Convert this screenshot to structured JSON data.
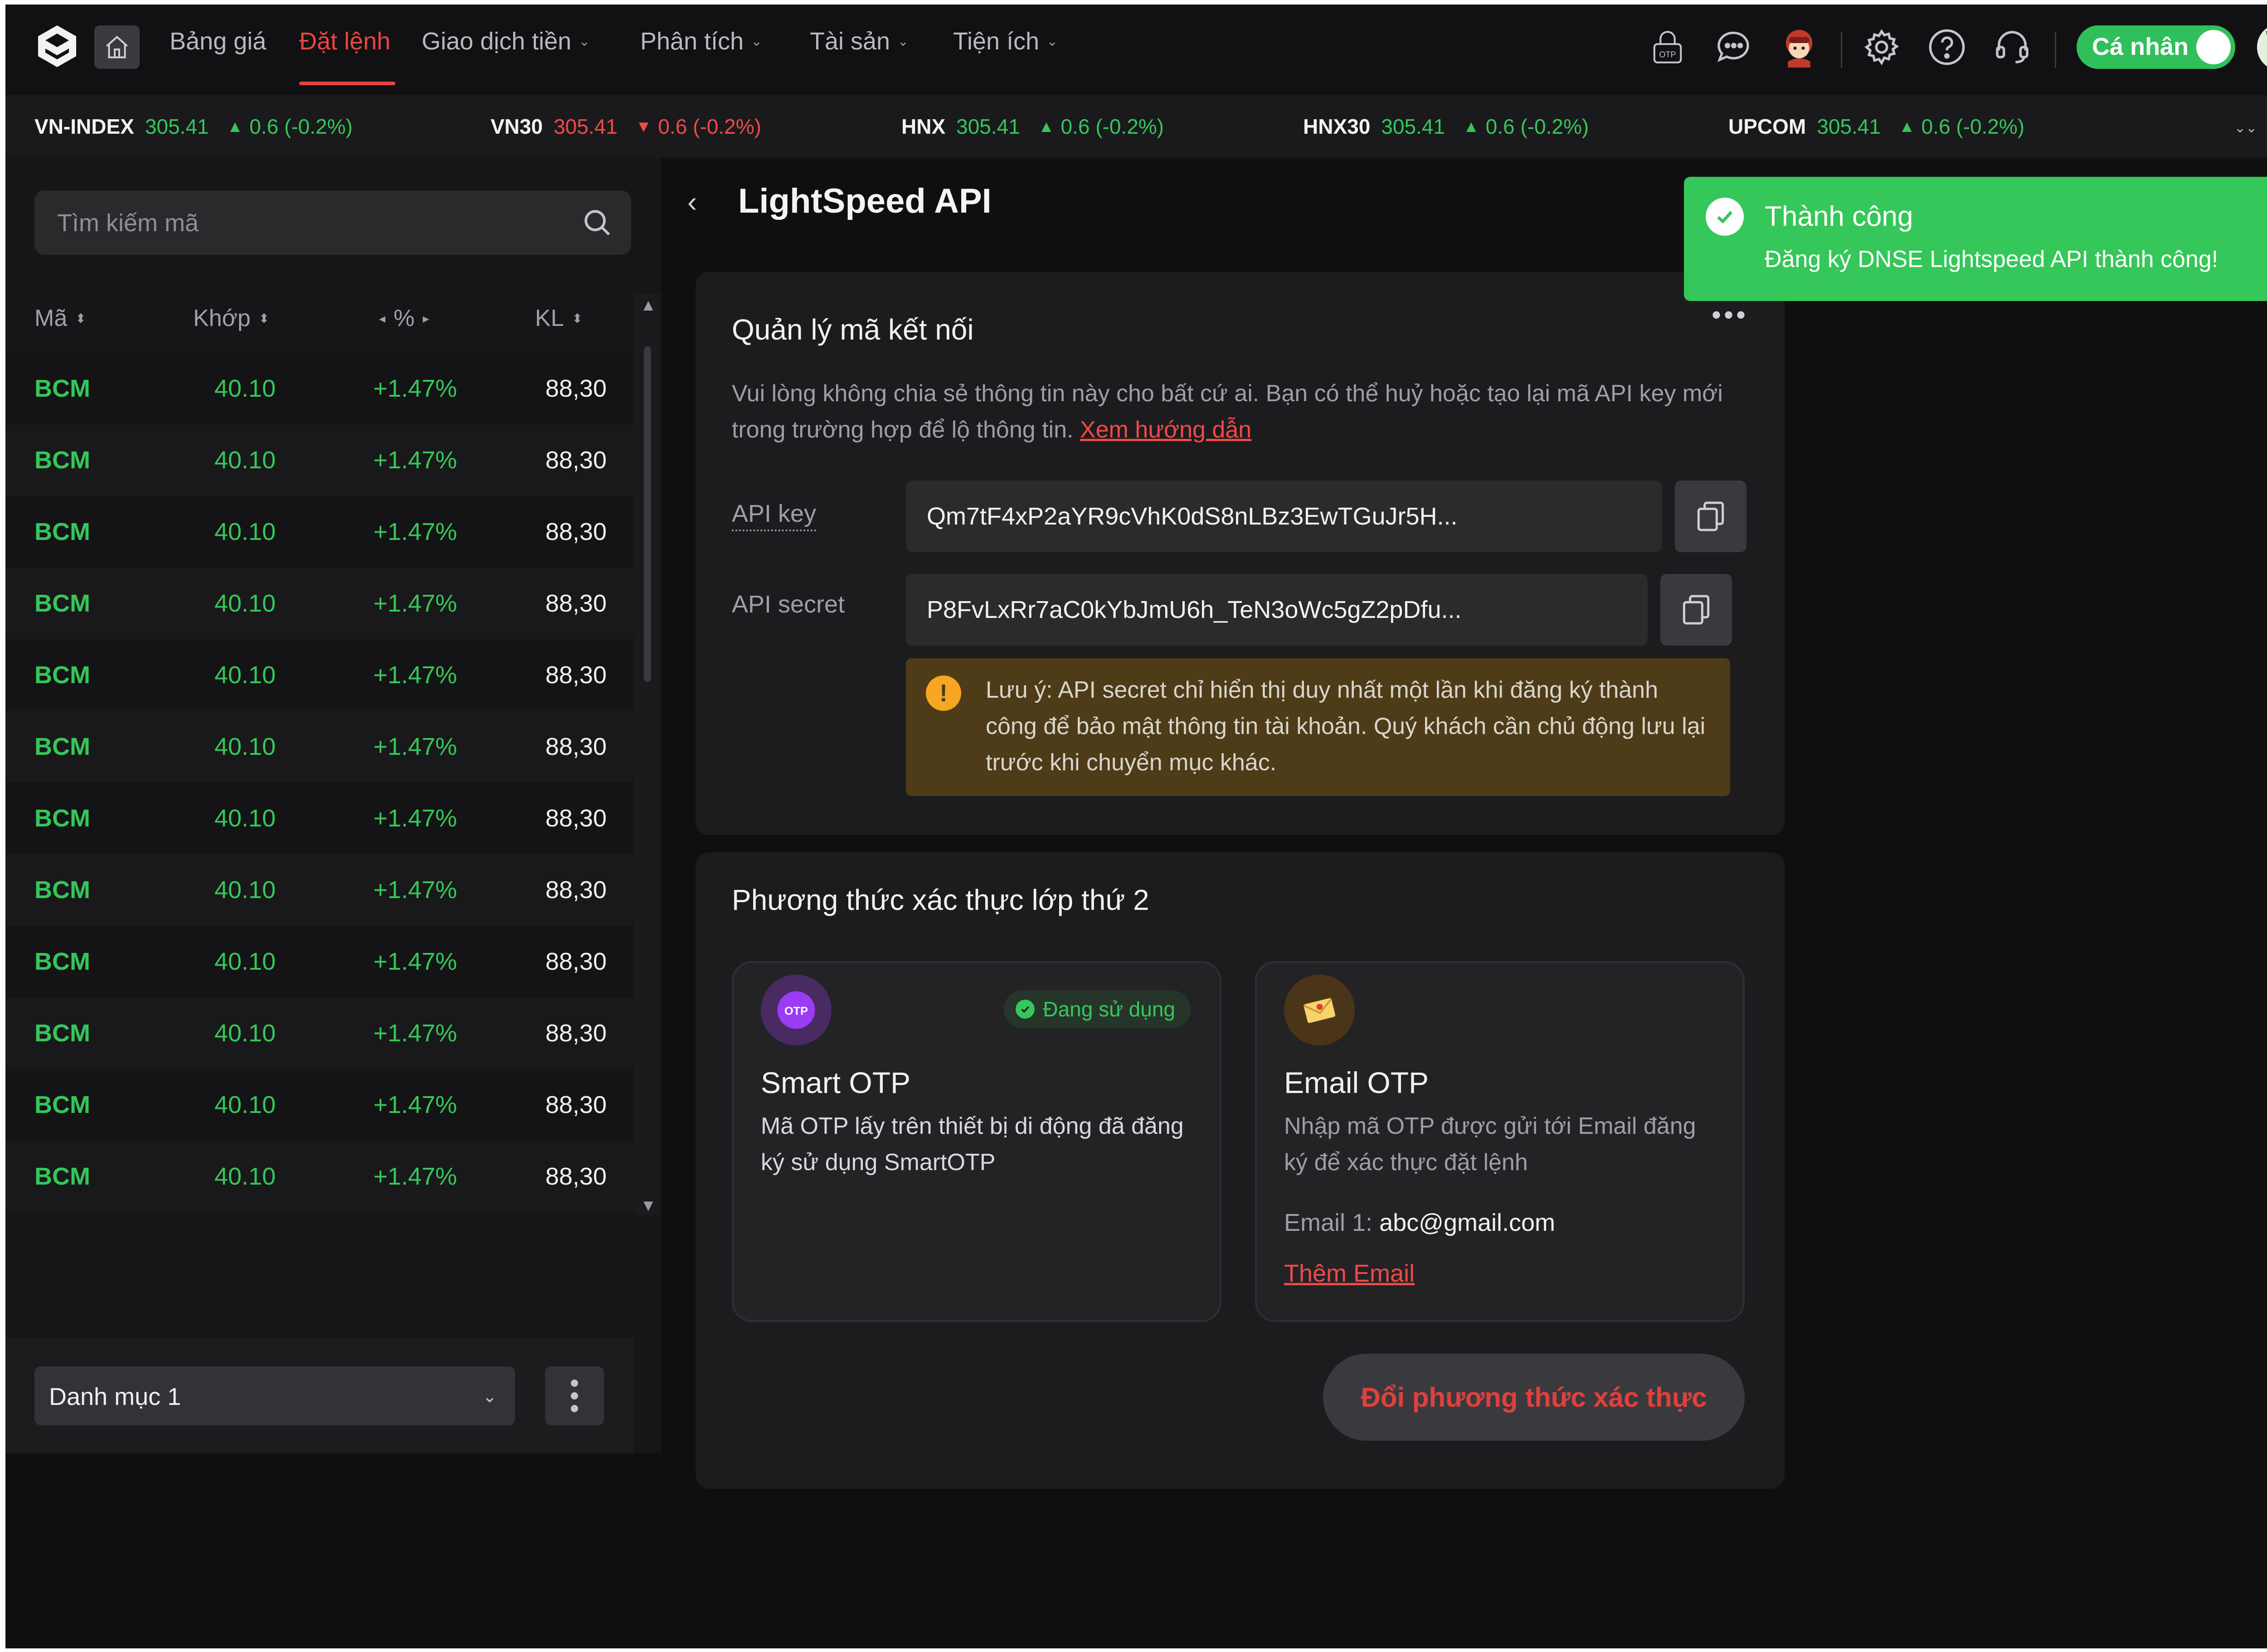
{
  "nav": {
    "items": [
      {
        "label": "Bảng giá",
        "has_menu": false,
        "active": false
      },
      {
        "label": "Đặt lệnh",
        "has_menu": false,
        "active": true
      },
      {
        "label": "Giao dịch tiền",
        "has_menu": true,
        "active": false
      },
      {
        "label": "Phân tích",
        "has_menu": true,
        "active": false
      },
      {
        "label": "Tài sản",
        "has_menu": true,
        "active": false
      },
      {
        "label": "Tiện ích",
        "has_menu": true,
        "active": false
      }
    ],
    "otp_icon_label": "OTP",
    "toggle_label": "Cá nhân",
    "icons": [
      "logo-icon",
      "home-icon",
      "otp-icon",
      "chat-icon",
      "mascot-icon",
      "settings-icon",
      "help-icon",
      "support-icon",
      "avatar"
    ]
  },
  "ticker": [
    {
      "name": "VN-INDEX",
      "value": "305.41",
      "change": "0.6 (-0.2%)",
      "direction": "up"
    },
    {
      "name": "VN30",
      "value": "305.41",
      "change": "0.6 (-0.2%)",
      "direction": "down"
    },
    {
      "name": "HNX",
      "value": "305.41",
      "change": "0.6 (-0.2%)",
      "direction": "up"
    },
    {
      "name": "HNX30",
      "value": "305.41",
      "change": "0.6 (-0.2%)",
      "direction": "up"
    },
    {
      "name": "UPCOM",
      "value": "305.41",
      "change": "0.6 (-0.2%)",
      "direction": "up"
    }
  ],
  "ticker_more_label": "Mở",
  "watchlist": {
    "search_placeholder": "Tìm kiếm mã",
    "columns": [
      "Mã",
      "Khớp",
      "%",
      "KL"
    ],
    "rows": [
      {
        "code": "BCM",
        "price": "40.10",
        "pct": "+1.47%",
        "vol": "88,30"
      },
      {
        "code": "BCM",
        "price": "40.10",
        "pct": "+1.47%",
        "vol": "88,30"
      },
      {
        "code": "BCM",
        "price": "40.10",
        "pct": "+1.47%",
        "vol": "88,30"
      },
      {
        "code": "BCM",
        "price": "40.10",
        "pct": "+1.47%",
        "vol": "88,30"
      },
      {
        "code": "BCM",
        "price": "40.10",
        "pct": "+1.47%",
        "vol": "88,30"
      },
      {
        "code": "BCM",
        "price": "40.10",
        "pct": "+1.47%",
        "vol": "88,30"
      },
      {
        "code": "BCM",
        "price": "40.10",
        "pct": "+1.47%",
        "vol": "88,30"
      },
      {
        "code": "BCM",
        "price": "40.10",
        "pct": "+1.47%",
        "vol": "88,30"
      },
      {
        "code": "BCM",
        "price": "40.10",
        "pct": "+1.47%",
        "vol": "88,30"
      },
      {
        "code": "BCM",
        "price": "40.10",
        "pct": "+1.47%",
        "vol": "88,30"
      },
      {
        "code": "BCM",
        "price": "40.10",
        "pct": "+1.47%",
        "vol": "88,30"
      },
      {
        "code": "BCM",
        "price": "40.10",
        "pct": "+1.47%",
        "vol": "88,30"
      }
    ],
    "category_select": "Danh mục 1"
  },
  "page": {
    "title": "LightSpeed API",
    "connection": {
      "title": "Quản lý mã kết nối",
      "description": "Vui lòng không chia sẻ thông tin này cho bất cứ ai. Bạn có thể huỷ hoặc tạo lại mã API key mới trong trường hợp để lộ thông tin.",
      "guide_link": "Xem hướng dẫn",
      "api_key_label": "API key",
      "api_key_value": "Qm7tF4xP2aYR9cVhK0dS8nLBz3EwTGuJr5H...",
      "api_secret_label": "API secret",
      "api_secret_value": "P8FvLxRr7aC0kYbJmU6h_TeN3oWc5gZ2pDfu...",
      "warning": "Lưu ý: API secret chỉ hiển thị duy nhất một lần khi đăng ký thành công để bảo mật thông tin tài khoản. Quý khách cần chủ động lưu lại trước khi chuyển mục khác."
    },
    "auth": {
      "title": "Phương thức xác thực lớp thứ 2",
      "smart_otp": {
        "icon_label": "OTP",
        "badge": "Đang sử dụng",
        "name": "Smart OTP",
        "description": "Mã OTP lấy trên thiết bị di động đã đăng ký sử dụng SmartOTP"
      },
      "email_otp": {
        "name": "Email OTP",
        "description": "Nhập mã OTP được gửi tới Email đăng ký để xác thực đặt lệnh",
        "email_label": "Email 1:",
        "email_value": "abc@gmail.com",
        "add_email": "Thêm Email"
      },
      "change_button": "Đổi phương thức xác thực"
    }
  },
  "toast": {
    "title": "Thành công",
    "message": "Đăng ký DNSE Lightspeed API thành công!"
  },
  "colors": {
    "accent_red": "#e9453f",
    "up_green": "#35c759",
    "down_red": "#ef4a47",
    "warning_bg": "#4e3b18",
    "toast_green": "#35c759"
  }
}
